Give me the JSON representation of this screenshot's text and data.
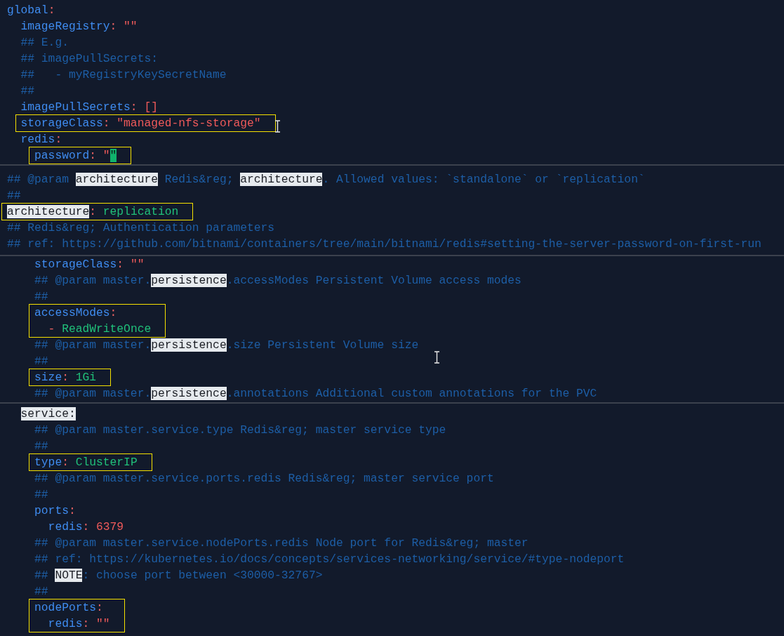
{
  "panels": [
    {
      "blocks": [
        {
          "lines": [
            {
              "tokens": [
                {
                  "kind": "key",
                  "text": "global"
                },
                {
                  "kind": "colon",
                  "text": ":"
                }
              ]
            }
          ],
          "children": [
            {
              "lines": [
                {
                  "tokens": [
                    {
                      "kind": "key",
                      "text": "imageRegistry"
                    },
                    {
                      "kind": "colon",
                      "text": ": "
                    },
                    {
                      "kind": "str",
                      "text": "\"\""
                    }
                  ]
                },
                {
                  "tokens": [
                    {
                      "kind": "comment",
                      "text": "## E.g."
                    }
                  ]
                },
                {
                  "tokens": [
                    {
                      "kind": "comment",
                      "text": "## imagePullSecrets:"
                    }
                  ]
                },
                {
                  "tokens": [
                    {
                      "kind": "comment",
                      "text": "##   - myRegistryKeySecretName"
                    }
                  ]
                },
                {
                  "tokens": [
                    {
                      "kind": "comment",
                      "text": "##"
                    }
                  ]
                },
                {
                  "tokens": [
                    {
                      "kind": "key",
                      "text": "imagePullSecrets"
                    },
                    {
                      "kind": "colon",
                      "text": ": "
                    },
                    {
                      "kind": "str",
                      "text": "[]"
                    }
                  ]
                }
              ]
            },
            {
              "boxed": true,
              "lines": [
                {
                  "tokens": [
                    {
                      "kind": "key",
                      "text": "storageClass"
                    },
                    {
                      "kind": "colon",
                      "text": ": "
                    },
                    {
                      "kind": "str",
                      "text": "\"managed-nfs-storage\""
                    }
                  ]
                }
              ]
            },
            {
              "lines": [
                {
                  "tokens": [
                    {
                      "kind": "key",
                      "text": "redis"
                    },
                    {
                      "kind": "colon",
                      "text": ":"
                    }
                  ]
                }
              ],
              "children": [
                {
                  "boxed": true,
                  "lines": [
                    {
                      "tokens": [
                        {
                          "kind": "key",
                          "text": "password"
                        },
                        {
                          "kind": "colon",
                          "text": ": "
                        },
                        {
                          "kind": "str",
                          "text": "\""
                        },
                        {
                          "kind": "cursor",
                          "text": "\""
                        }
                      ]
                    }
                  ]
                }
              ]
            }
          ]
        }
      ]
    },
    {
      "blocks": [
        {
          "lines": [
            {
              "tokens": [
                {
                  "kind": "comment",
                  "text": "## @param "
                },
                {
                  "kind": "match",
                  "text": "architecture"
                },
                {
                  "kind": "comment",
                  "text": " Redis&reg; "
                },
                {
                  "kind": "match",
                  "text": "architecture"
                },
                {
                  "kind": "comment",
                  "text": ". Allowed values: `standalone` or `replication`"
                }
              ]
            },
            {
              "tokens": [
                {
                  "kind": "comment",
                  "text": "##"
                }
              ]
            }
          ]
        },
        {
          "boxed": true,
          "lines": [
            {
              "tokens": [
                {
                  "kind": "match",
                  "text": "architecture"
                },
                {
                  "kind": "colon",
                  "text": ": "
                },
                {
                  "kind": "val",
                  "text": "replication"
                }
              ]
            }
          ]
        },
        {
          "lines": [
            {
              "tokens": [
                {
                  "kind": "comment",
                  "text": "## Redis&reg; Authentication parameters"
                }
              ]
            },
            {
              "tokens": [
                {
                  "kind": "comment",
                  "text": "## ref: https://github.com/bitnami/containers/tree/main/bitnami/redis#setting-the-server-password-on-first-run"
                }
              ]
            }
          ]
        }
      ]
    },
    {
      "blocks": [
        {
          "children": [
            {
              "children": [
                {
                  "lines": [
                    {
                      "tokens": [
                        {
                          "kind": "key",
                          "text": "storageClass"
                        },
                        {
                          "kind": "colon",
                          "text": ": "
                        },
                        {
                          "kind": "str",
                          "text": "\"\""
                        }
                      ]
                    },
                    {
                      "tokens": [
                        {
                          "kind": "comment",
                          "text": "## @param master."
                        },
                        {
                          "kind": "match",
                          "text": "persistence"
                        },
                        {
                          "kind": "comment",
                          "text": ".accessModes Persistent Volume access modes"
                        }
                      ]
                    },
                    {
                      "tokens": [
                        {
                          "kind": "comment",
                          "text": "##"
                        }
                      ]
                    }
                  ]
                },
                {
                  "boxed": true,
                  "lines": [
                    {
                      "tokens": [
                        {
                          "kind": "key",
                          "text": "accessModes"
                        },
                        {
                          "kind": "colon",
                          "text": ":"
                        }
                      ]
                    },
                    {
                      "tokens": [
                        {
                          "kind": "colon",
                          "text": "  - "
                        },
                        {
                          "kind": "val",
                          "text": "ReadWriteOnce"
                        }
                      ]
                    }
                  ]
                },
                {
                  "lines": [
                    {
                      "tokens": [
                        {
                          "kind": "comment",
                          "text": "## @param master."
                        },
                        {
                          "kind": "match",
                          "text": "persistence"
                        },
                        {
                          "kind": "comment",
                          "text": ".size Persistent Volume size"
                        }
                      ]
                    },
                    {
                      "tokens": [
                        {
                          "kind": "comment",
                          "text": "##"
                        }
                      ]
                    }
                  ]
                },
                {
                  "boxed": true,
                  "lines": [
                    {
                      "tokens": [
                        {
                          "kind": "key",
                          "text": "size"
                        },
                        {
                          "kind": "colon",
                          "text": ": "
                        },
                        {
                          "kind": "val",
                          "text": "1Gi"
                        }
                      ]
                    }
                  ]
                },
                {
                  "lines": [
                    {
                      "tokens": [
                        {
                          "kind": "comment",
                          "text": "## @param master."
                        },
                        {
                          "kind": "match",
                          "text": "persistence"
                        },
                        {
                          "kind": "comment",
                          "text": ".annotations Additional custom annotations for the PVC"
                        }
                      ]
                    }
                  ]
                }
              ]
            }
          ]
        }
      ]
    },
    {
      "blocks": [
        {
          "children": [
            {
              "lines": [
                {
                  "tokens": [
                    {
                      "kind": "match",
                      "text": "service:"
                    }
                  ]
                }
              ],
              "children": [
                {
                  "lines": [
                    {
                      "tokens": [
                        {
                          "kind": "comment",
                          "text": "## @param master.service.type Redis&reg; master service type"
                        }
                      ]
                    },
                    {
                      "tokens": [
                        {
                          "kind": "comment",
                          "text": "##"
                        }
                      ]
                    }
                  ]
                },
                {
                  "boxed": true,
                  "lines": [
                    {
                      "tokens": [
                        {
                          "kind": "key",
                          "text": "type"
                        },
                        {
                          "kind": "colon",
                          "text": ": "
                        },
                        {
                          "kind": "val",
                          "text": "ClusterIP"
                        }
                      ]
                    }
                  ]
                },
                {
                  "lines": [
                    {
                      "tokens": [
                        {
                          "kind": "comment",
                          "text": "## @param master.service.ports.redis Redis&reg; master service port"
                        }
                      ]
                    },
                    {
                      "tokens": [
                        {
                          "kind": "comment",
                          "text": "##"
                        }
                      ]
                    },
                    {
                      "tokens": [
                        {
                          "kind": "key",
                          "text": "ports"
                        },
                        {
                          "kind": "colon",
                          "text": ":"
                        }
                      ]
                    },
                    {
                      "tokens": [
                        {
                          "kind": "key",
                          "text": "  redis"
                        },
                        {
                          "kind": "colon",
                          "text": ": "
                        },
                        {
                          "kind": "num",
                          "text": "6379"
                        }
                      ]
                    },
                    {
                      "tokens": [
                        {
                          "kind": "comment",
                          "text": "## @param master.service.nodePorts.redis Node port for Redis&reg; master"
                        }
                      ]
                    },
                    {
                      "tokens": [
                        {
                          "kind": "comment",
                          "text": "## ref: https://kubernetes.io/docs/concepts/services-networking/service/#type-nodeport"
                        }
                      ]
                    },
                    {
                      "tokens": [
                        {
                          "kind": "comment",
                          "text": "## "
                        },
                        {
                          "kind": "match",
                          "text": "NOTE"
                        },
                        {
                          "kind": "comment",
                          "text": ": choose port between <30000-32767>"
                        }
                      ]
                    },
                    {
                      "tokens": [
                        {
                          "kind": "comment",
                          "text": "##"
                        }
                      ]
                    }
                  ]
                },
                {
                  "boxed": true,
                  "lines": [
                    {
                      "tokens": [
                        {
                          "kind": "key",
                          "text": "nodePorts"
                        },
                        {
                          "kind": "colon",
                          "text": ":"
                        }
                      ]
                    },
                    {
                      "tokens": [
                        {
                          "kind": "key",
                          "text": "  redis"
                        },
                        {
                          "kind": "colon",
                          "text": ": "
                        },
                        {
                          "kind": "str",
                          "text": "\"\""
                        }
                      ]
                    }
                  ]
                }
              ]
            }
          ]
        }
      ]
    }
  ]
}
